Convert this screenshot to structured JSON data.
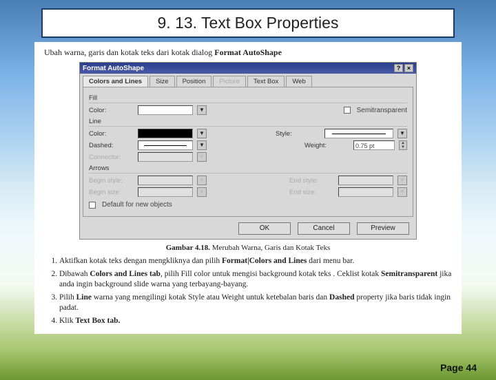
{
  "slide": {
    "title": "9. 13. Text Box Properties",
    "page_label": "Page 44"
  },
  "intro": {
    "prefix": "Ubah warna, garis dan kotak teks dari kotak dialog ",
    "bold": "Format AutoShape"
  },
  "dialog": {
    "title": "Format AutoShape",
    "help": "?",
    "close": "×",
    "tabs": {
      "colors": "Colors and Lines",
      "size": "Size",
      "position": "Position",
      "picture": "Picture",
      "textbox": "Text Box",
      "web": "Web"
    },
    "groups": {
      "fill": "Fill",
      "line": "Line",
      "arrows": "Arrows"
    },
    "labels": {
      "color": "Color:",
      "semitrans": "Semitransparent",
      "style": "Style:",
      "dashed": "Dashed:",
      "weight": "Weight:",
      "connector": "Connector:",
      "begin_style": "Begin style:",
      "end_style": "End style:",
      "begin_size": "Begin size:",
      "end_size": "End size:",
      "default_new": "Default for new objects"
    },
    "values": {
      "weight": "0.75 pt"
    },
    "buttons": {
      "ok": "OK",
      "cancel": "Cancel",
      "preview": "Preview"
    }
  },
  "caption": {
    "bold": "Gambar 4.18.",
    "text": " Merubah Warna, Garis dan Kotak Teks"
  },
  "steps": {
    "s1a": "Aktifkan kotak teks dengan mengkliknya dan pilih ",
    "s1b": "Format|Colors and Lines",
    "s1c": " dari menu bar.",
    "s2a": "Dibawah ",
    "s2b": "Colors and Lines tab",
    "s2c": ", pilih Fill color untuk mengisi background kotak teks . Ceklist kotak ",
    "s2d": "Semitransparent",
    "s2e": " jika anda ingin background slide warna yang terbayang-bayang.",
    "s3a": "Pilih ",
    "s3b": "Line",
    "s3c": " warna yang mengilingi kotak Style atau Weight untuk ketebalan baris dan ",
    "s3d": "Dashed",
    "s3e": " property jika baris tidak ingin padat.",
    "s4a": "Klik ",
    "s4b": "Text Box tab."
  }
}
